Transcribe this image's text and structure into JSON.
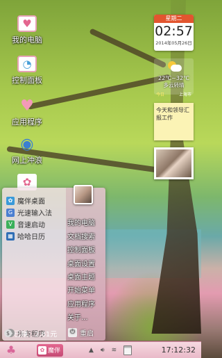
{
  "desktop": {
    "icons": [
      {
        "label": "我的电脑",
        "icon": "computer-icon"
      },
      {
        "label": "控制面板",
        "icon": "control-panel-icon"
      },
      {
        "label": "应用程序",
        "icon": "apps-icon"
      },
      {
        "label": "网上冲浪",
        "icon": "browser-icon"
      }
    ]
  },
  "widgets": {
    "clock": {
      "weekday": "星期二",
      "time": "02:57",
      "date": "2014年05月26日"
    },
    "weather": {
      "temp": "22℃~32℃",
      "condition": "多云转晴",
      "day": "今日",
      "city": "上海市"
    },
    "note": {
      "text": "今天和领导汇报工作"
    }
  },
  "start_menu": {
    "programs": [
      {
        "label": "魔伴桌面",
        "color": "#3a9ad9",
        "glyph": "✿"
      },
      {
        "label": "光速输入法",
        "color": "#4b7fd1",
        "glyph": "G"
      },
      {
        "label": "音速启动",
        "color": "#3bb05a",
        "glyph": "V"
      },
      {
        "label": "哈哈日历",
        "color": "#2f6db5",
        "glyph": "▦"
      }
    ],
    "all_programs": "所有程序",
    "places": [
      "我的电脑",
      "文档搜索",
      "控制面板",
      "桌面设置",
      "桌面主题",
      "开始菜单",
      "应用程序",
      "关于..."
    ],
    "balance": "已赚：2.61元",
    "restart": "重启"
  },
  "taskbar": {
    "app_label": "魔伴",
    "time": "17:12:32"
  },
  "colors": {
    "accent": "#e3668f",
    "taskbar": "#f6d9e1"
  }
}
